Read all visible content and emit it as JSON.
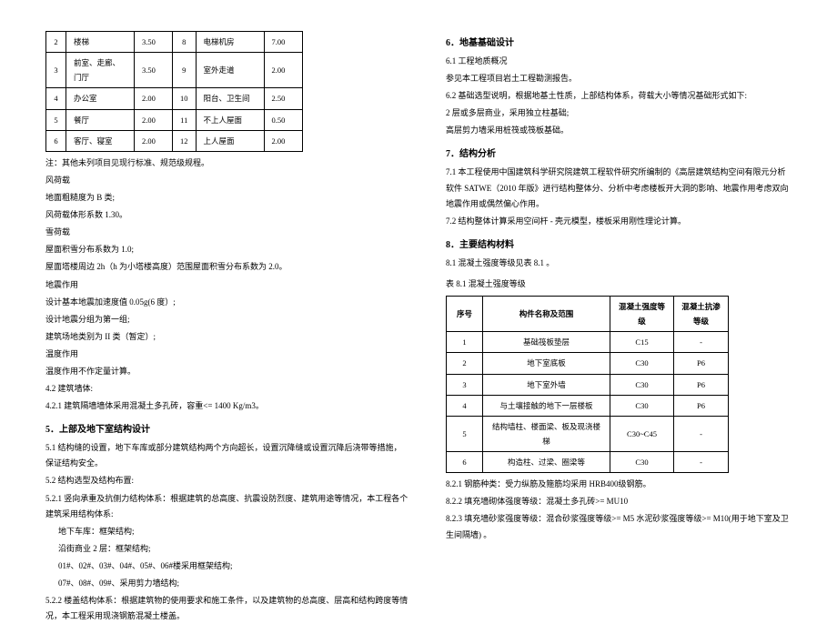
{
  "loads": [
    {
      "n1": "2",
      "r1": "楼梯",
      "v1": "3.50",
      "n2": "8",
      "r2": "电梯机房",
      "v2": "7.00"
    },
    {
      "n1": "3",
      "r1": "前室、走廊、门厅",
      "v1": "3.50",
      "n2": "9",
      "r2": "室外走道",
      "v2": "2.00"
    },
    {
      "n1": "4",
      "r1": "办公室",
      "v1": "2.00",
      "n2": "10",
      "r2": "阳台、卫生间",
      "v2": "2.50"
    },
    {
      "n1": "5",
      "r1": "餐厅",
      "v1": "2.00",
      "n2": "11",
      "r2": "不上人屋面",
      "v2": "0.50"
    },
    {
      "n1": "6",
      "r1": "客厅、寝室",
      "v1": "2.00",
      "n2": "12",
      "r2": "上人屋面",
      "v2": "2.00"
    }
  ],
  "note_after_table": "注：其他未列项目见现行标准、规范级规程。",
  "wind": {
    "title": "风荷载",
    "rough": "地面粗糙度为   B 类;",
    "shape": "风荷载体形系数   1.30。",
    "snow_title": "雪荷载",
    "snow_coef": "屋面积雪分布系数为   1.0;",
    "snow_tower": "屋面塔楼周边   2h（h 为小塔楼高度）范围屋面积雪分布系数为      2.0。",
    "quake_title": "地震作用",
    "quake_acc": "设计基本地震加速度值   0.05g(6 度）;",
    "quake_group": "设计地震分组为第一组;",
    "site_class": "建筑场地类别为   II  类（暂定）;",
    "temp_title": "温度作用",
    "temp_note": "温度作用不作定量计算。"
  },
  "s42": {
    "h": "4.2       建筑墙体:",
    "p1": "4.2.1     建筑隔墙墙体采用混凝土多孔砖，容重<=   1400 Kg/m3。"
  },
  "s5": {
    "h": "5．上部及地下室结构设计",
    "p51": "5.1       结构缝的设置，地下车库或部分建筑结构两个方向超长，设置沉降缝或设置沉降后浇带等措施，保证结构安全。",
    "p52": "5.2       结构选型及结构布置:",
    "p521": "5.2.1     竖向承重及抗侧力结构体系：根据建筑的总高度、抗震设防烈度、建筑用途等情况，本工程各个建筑采用结构体系:",
    "p521a": "地下车库：框架结构;",
    "p521b": "沿街商业  2 层：框架结构;",
    "p521c": "01#、02#、03#、04#、05#、06#楼采用框架结构;",
    "p521d": "07#、08#、09#、采用剪力墙结构;",
    "p522": "5.2.2     楼盖结构体系：根据建筑物的使用要求和施工条件，以及建筑物的总高度、层高和结构跨度等情况，本工程采用现浇钢筋混凝土楼盖。"
  },
  "s6": {
    "h": "6．地基基础设计",
    "p61": "6.1     工程地质概况",
    "p61a": "参见本工程项目岩土工程勘测报告。",
    "p62": "6.2     基础选型说明，根据地基土性质，上部结构体系，荷载大小等情况基础形式如下:",
    "p62a": "2 层或多层商业，采用独立柱基础;",
    "p62b": "高层剪力墙采用桩筏或筏板基础。"
  },
  "s7": {
    "h": "7．结构分析",
    "p71": "7.1     本工程使用中国建筑科学研究院建筑工程软件研究所编制的《高层建筑结构空间有限元分析软件           SATWE（2010 年版》进行结构整体分、分析中考虑楼板开大洞的影响、地震作用考虑双向地震作用或偶然偏心作用。",
    "p72": "7.2       结构整体计算采用空间杆    - 壳元模型，楼板采用刚性理论计算。"
  },
  "s8": {
    "h": "8．主要结构材料",
    "p81": "8.1     混凝土强度等级见表   8.1 。",
    "tcap": "表 8.1 混凝土强度等级",
    "th": [
      "序号",
      "构件名称及范围",
      "混凝土强度等级",
      "混凝土抗渗等级"
    ],
    "rows": [
      {
        "n": "1",
        "name": "基础筏板垫层",
        "s": "C15",
        "p": "-"
      },
      {
        "n": "2",
        "name": "地下室底板",
        "s": "C30",
        "p": "P6"
      },
      {
        "n": "3",
        "name": "地下室外墙",
        "s": "C30",
        "p": "P6"
      },
      {
        "n": "4",
        "name": "与土壤接触的地下一层楼板",
        "s": "C30",
        "p": "P6"
      },
      {
        "n": "5",
        "name": "结构墙柱、楼面梁、板及现浇楼梯",
        "s": "C30~C45",
        "p": "-"
      },
      {
        "n": "6",
        "name": "构造柱、过梁、圈梁等",
        "s": "C30",
        "p": "-"
      }
    ],
    "p821": "8.2.1     钢筋种类：受力纵筋及箍筋均采用   HRB400级钢筋。",
    "p822": "8.2.2     填充墙砌体强度等级：混凝土多孔砖>=   MU10",
    "p823": "8.2.3     填充墙砂浆强度等级：混合砂浆强度等级>=  M5  水泥砂浆强度等级>=  M10(用于地下室及卫生间隔墙)   。"
  }
}
